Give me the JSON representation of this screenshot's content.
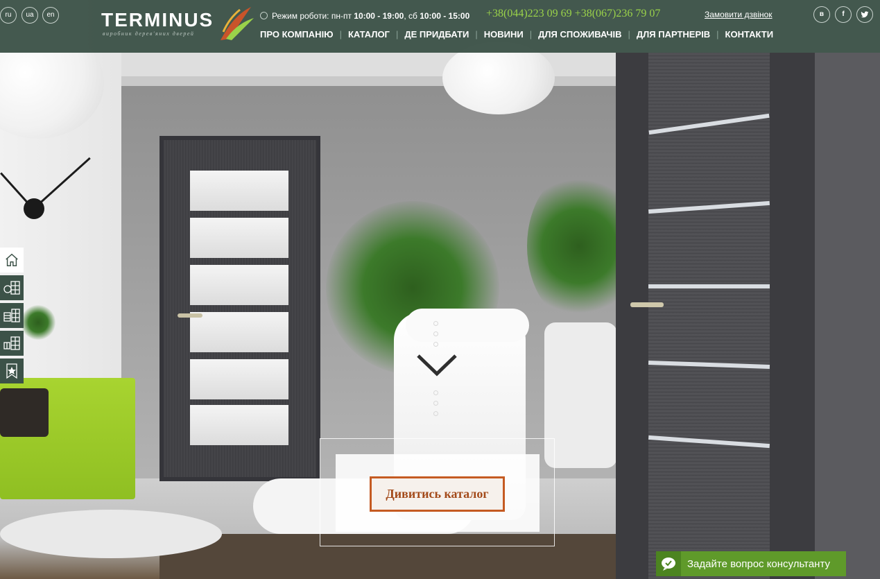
{
  "header": {
    "languages": [
      "ru",
      "ua",
      "en"
    ],
    "logo": {
      "title": "TERMINUS",
      "subtitle": "виробник дерев'яних дверей"
    },
    "hours": {
      "label": "Режим роботи: пн-пт ",
      "weekday": "10:00 - 19:00",
      "sep": ", сб ",
      "saturday": "10:00 - 15:00"
    },
    "phones": "+38(044)223 09 69 +38(067)236 79 07",
    "callback_label": "Замовити дзвінок",
    "social": [
      {
        "label": "в",
        "icon": "vk-icon"
      },
      {
        "label": "f",
        "icon": "facebook-icon"
      },
      {
        "label": "t",
        "icon": "twitter-icon"
      }
    ],
    "nav": [
      "ПРО КОМПАНІЮ",
      "КАТАЛОГ",
      "ДЕ ПРИДБАТИ",
      "НОВИНИ",
      "ДЛЯ СПОЖИВАЧІВ",
      "ДЛЯ ПАРТНЕРІВ",
      "КОНТАКТИ"
    ]
  },
  "sidebar": {
    "icons": [
      "home-icon",
      "catalog-doors-icon",
      "catalog-list-icon",
      "catalog-grid-icon",
      "favorites-icon"
    ]
  },
  "hero": {
    "cta_label": "Дивитись каталог"
  },
  "consultant": {
    "label": "Задайте вопрос консультанту"
  },
  "colors": {
    "header_bg": "#3c5248",
    "phone_green": "#9ad24a",
    "cta_border": "#c55b22",
    "consult_bg": "#5f9a2a"
  }
}
